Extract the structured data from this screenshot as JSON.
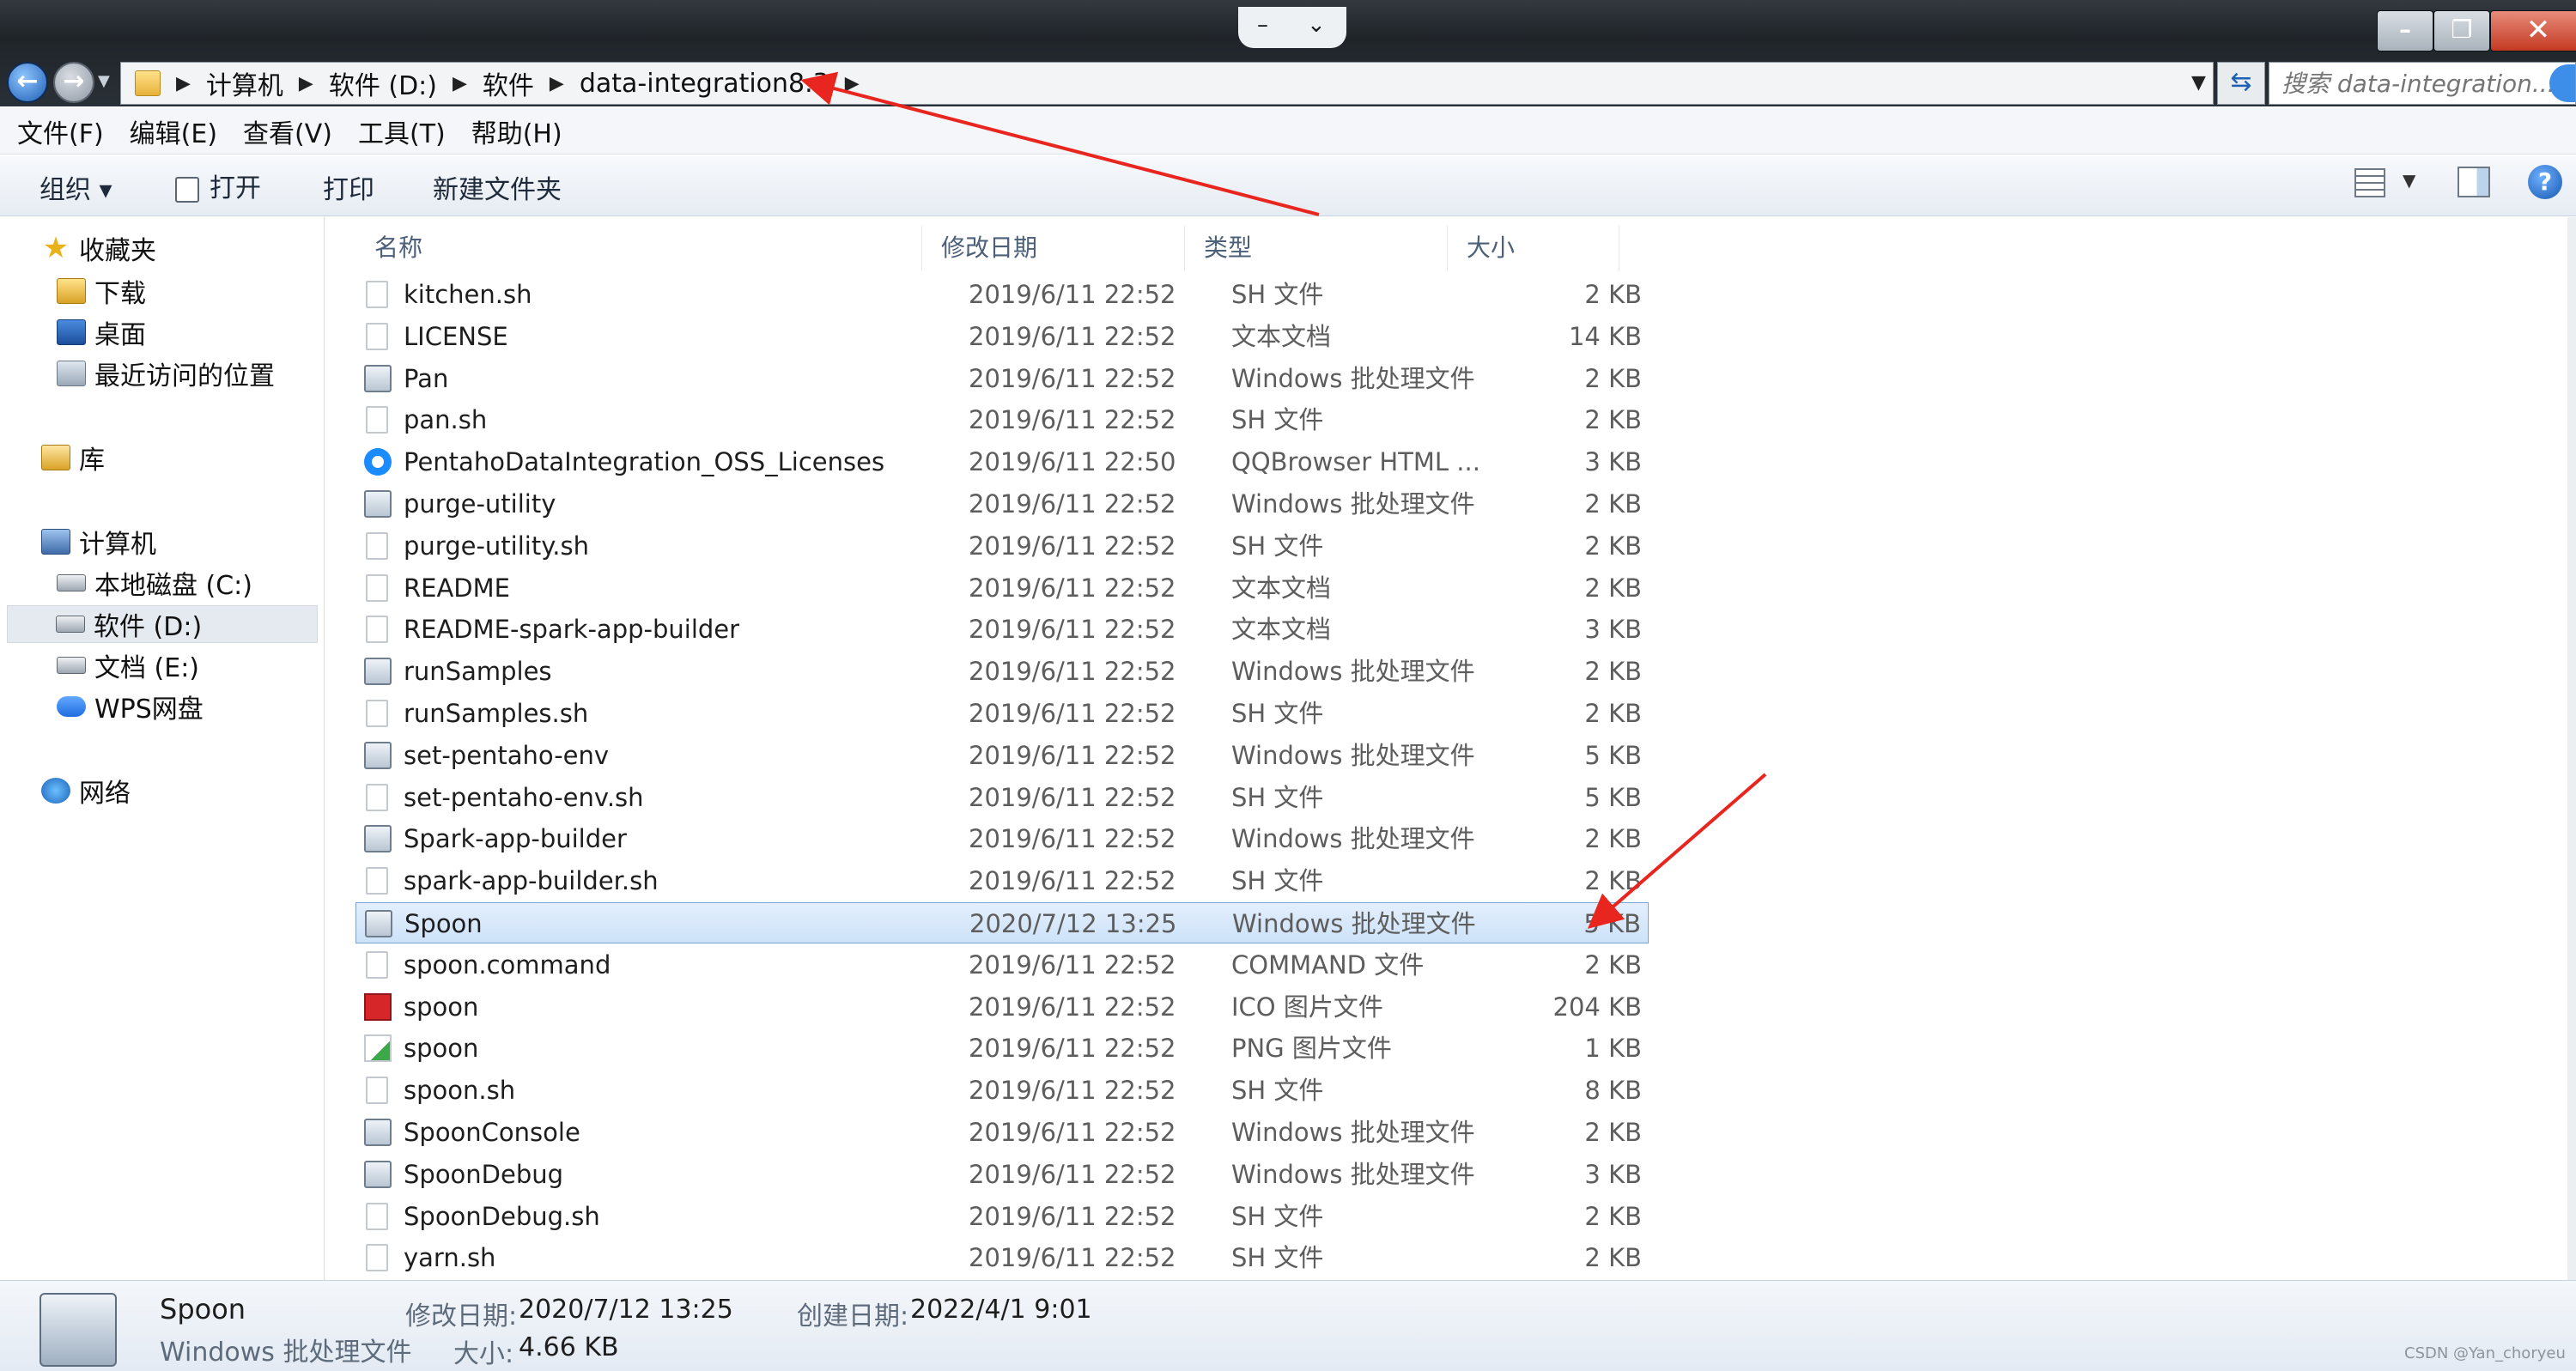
{
  "window": {
    "dock_tab": {
      "left": "–",
      "right": "⌄"
    },
    "controls": {
      "minimize": "–",
      "maximize": "❐",
      "close": "✕"
    },
    "nav": {
      "back_icon": "back-arrow-icon",
      "forward_icon": "forward-arrow-icon"
    }
  },
  "address_bar": {
    "crumbs": [
      "计算机",
      "软件 (D:)",
      "软件",
      "data-integration8.3"
    ],
    "separator": "▶",
    "search_placeholder": "搜索 data-integration..."
  },
  "menu": [
    "文件(F)",
    "编辑(E)",
    "查看(V)",
    "工具(T)",
    "帮助(H)"
  ],
  "toolbar": {
    "organize": "组织 ▾",
    "open": "打开",
    "print": "打印",
    "new_folder": "新建文件夹",
    "help": "?"
  },
  "sidebar": {
    "favorites": "收藏夹",
    "favorites_items": [
      "下载",
      "桌面",
      "最近访问的位置"
    ],
    "libraries": "库",
    "computer": "计算机",
    "drives": [
      "本地磁盘 (C:)",
      "软件 (D:)",
      "文档 (E:)",
      "WPS网盘"
    ],
    "selected_drive": "软件 (D:)",
    "network": "网络"
  },
  "columns": [
    "名称",
    "修改日期",
    "类型",
    "大小"
  ],
  "files": [
    {
      "name": "kitchen.sh",
      "date": "2019/6/11 22:52",
      "type": "SH 文件",
      "size": "2 KB",
      "icon": "file"
    },
    {
      "name": "LICENSE",
      "date": "2019/6/11 22:52",
      "type": "文本文档",
      "size": "14 KB",
      "icon": "file"
    },
    {
      "name": "Pan",
      "date": "2019/6/11 22:52",
      "type": "Windows 批处理文件",
      "size": "2 KB",
      "icon": "bat"
    },
    {
      "name": "pan.sh",
      "date": "2019/6/11 22:52",
      "type": "SH 文件",
      "size": "2 KB",
      "icon": "file"
    },
    {
      "name": "PentahoDataIntegration_OSS_Licenses",
      "date": "2019/6/11 22:50",
      "type": "QQBrowser HTML ...",
      "size": "3 KB",
      "icon": "html"
    },
    {
      "name": "purge-utility",
      "date": "2019/6/11 22:52",
      "type": "Windows 批处理文件",
      "size": "2 KB",
      "icon": "bat"
    },
    {
      "name": "purge-utility.sh",
      "date": "2019/6/11 22:52",
      "type": "SH 文件",
      "size": "2 KB",
      "icon": "file"
    },
    {
      "name": "README",
      "date": "2019/6/11 22:52",
      "type": "文本文档",
      "size": "2 KB",
      "icon": "file"
    },
    {
      "name": "README-spark-app-builder",
      "date": "2019/6/11 22:52",
      "type": "文本文档",
      "size": "3 KB",
      "icon": "file"
    },
    {
      "name": "runSamples",
      "date": "2019/6/11 22:52",
      "type": "Windows 批处理文件",
      "size": "2 KB",
      "icon": "bat"
    },
    {
      "name": "runSamples.sh",
      "date": "2019/6/11 22:52",
      "type": "SH 文件",
      "size": "2 KB",
      "icon": "file"
    },
    {
      "name": "set-pentaho-env",
      "date": "2019/6/11 22:52",
      "type": "Windows 批处理文件",
      "size": "5 KB",
      "icon": "bat"
    },
    {
      "name": "set-pentaho-env.sh",
      "date": "2019/6/11 22:52",
      "type": "SH 文件",
      "size": "5 KB",
      "icon": "file"
    },
    {
      "name": "Spark-app-builder",
      "date": "2019/6/11 22:52",
      "type": "Windows 批处理文件",
      "size": "2 KB",
      "icon": "bat"
    },
    {
      "name": "spark-app-builder.sh",
      "date": "2019/6/11 22:52",
      "type": "SH 文件",
      "size": "2 KB",
      "icon": "file"
    },
    {
      "name": "Spoon",
      "date": "2020/7/12 13:25",
      "type": "Windows 批处理文件",
      "size": "5 KB",
      "icon": "bat",
      "selected": true
    },
    {
      "name": "spoon.command",
      "date": "2019/6/11 22:52",
      "type": "COMMAND 文件",
      "size": "2 KB",
      "icon": "file"
    },
    {
      "name": "spoon",
      "date": "2019/6/11 22:52",
      "type": "ICO 图片文件",
      "size": "204 KB",
      "icon": "ico"
    },
    {
      "name": "spoon",
      "date": "2019/6/11 22:52",
      "type": "PNG 图片文件",
      "size": "1 KB",
      "icon": "png"
    },
    {
      "name": "spoon.sh",
      "date": "2019/6/11 22:52",
      "type": "SH 文件",
      "size": "8 KB",
      "icon": "file"
    },
    {
      "name": "SpoonConsole",
      "date": "2019/6/11 22:52",
      "type": "Windows 批处理文件",
      "size": "2 KB",
      "icon": "bat"
    },
    {
      "name": "SpoonDebug",
      "date": "2019/6/11 22:52",
      "type": "Windows 批处理文件",
      "size": "3 KB",
      "icon": "bat"
    },
    {
      "name": "SpoonDebug.sh",
      "date": "2019/6/11 22:52",
      "type": "SH 文件",
      "size": "2 KB",
      "icon": "file"
    },
    {
      "name": "yarn.sh",
      "date": "2019/6/11 22:52",
      "type": "SH 文件",
      "size": "2 KB",
      "icon": "file"
    }
  ],
  "details": {
    "name": "Spoon",
    "type": "Windows 批处理文件",
    "modified_label": "修改日期:",
    "modified": "2020/7/12 13:25",
    "created_label": "创建日期:",
    "created": "2022/4/1 9:01",
    "size_label": "大小:",
    "size": "4.66 KB"
  },
  "watermark": "CSDN @Yan_choryeu",
  "colors": {
    "annotation": "#e8261f",
    "selection": "#cde2f9",
    "titlebar": "#1f2429"
  }
}
